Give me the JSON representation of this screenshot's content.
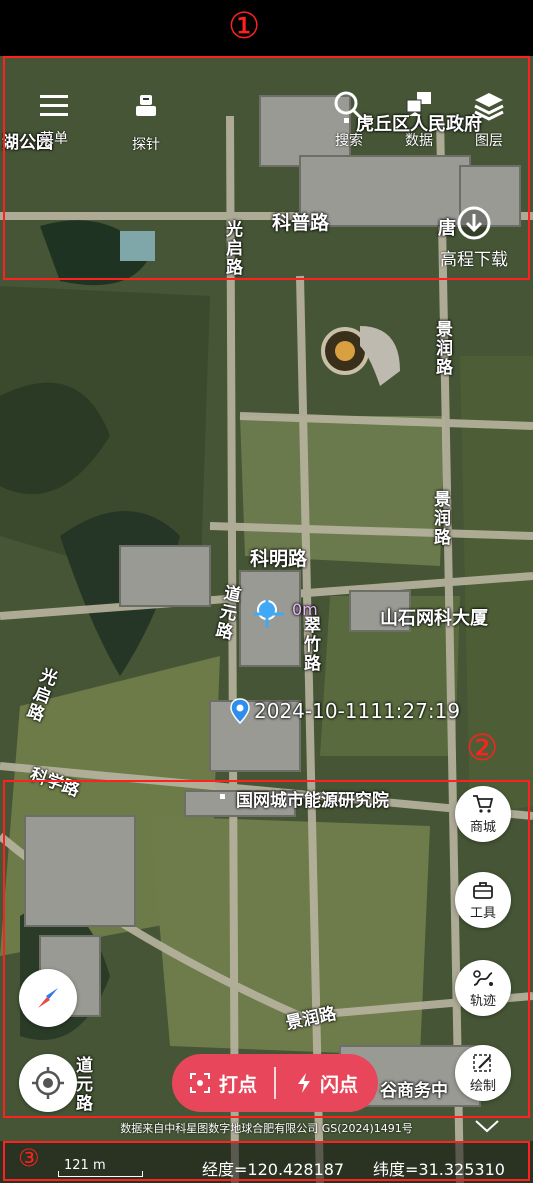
{
  "toolbar": {
    "menu_label": "菜单",
    "probe_label": "探针",
    "search_label": "搜索",
    "data_label": "数据",
    "layers_label": "图层",
    "elevation_label": "高程下载"
  },
  "map": {
    "labels": {
      "keyan": "科普路",
      "kemingLu": "科明路",
      "guangqi": "光启路",
      "guangqi2": "光启路",
      "jingrun": "景润路",
      "jingrun2": "景润路",
      "jingrun3": "景润路",
      "daoyuan": "道元路",
      "daoyuan2": "道元路",
      "zhubo": "翠竹路",
      "kexue": "科学路",
      "building1": "山石网科大厦",
      "building2": "国网城市能源研究院",
      "tiger": "虎丘区人民政府",
      "tang": "唐",
      "hubai": "湖公园",
      "daiyan": "谷商务中"
    },
    "marker_distance": "0m",
    "timestamp": "2024-10-1111:27:19",
    "copyright": "数据来自中科星图数字地球合肥有限公司 GS(2024)1491号"
  },
  "side_buttons": {
    "mall": "商城",
    "tools": "工具",
    "track": "轨迹",
    "draw": "绘制"
  },
  "actions": {
    "dot": "打点",
    "flash": "闪点"
  },
  "bottom": {
    "scale": "121 m",
    "lon": "经度=120.428187",
    "lat": "纬度=31.325310"
  },
  "annotations": {
    "n1": "①",
    "n2": "②",
    "n3": "③"
  },
  "colors": {
    "accent": "#e8475b",
    "annotation": "#ff2020"
  }
}
